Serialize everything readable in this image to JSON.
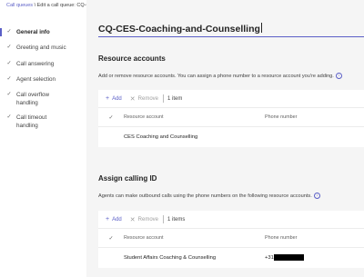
{
  "breadcrumb": {
    "parent": "Call queues",
    "separator": "\\",
    "current": "Edit a call queue: CQ-CES-Coaching-and-Counselling"
  },
  "sidebar": {
    "items": [
      {
        "label": "General info",
        "active": true,
        "checked": true
      },
      {
        "label": "Greeting and music",
        "active": false,
        "checked": true
      },
      {
        "label": "Call answering",
        "active": false,
        "checked": true
      },
      {
        "label": "Agent selection",
        "active": false,
        "checked": true
      },
      {
        "label": "Call overflow handling",
        "active": false,
        "checked": true
      },
      {
        "label": "Call timeout handling",
        "active": false,
        "checked": true
      }
    ]
  },
  "queue_name": "CQ-CES-Coaching-and-Counselling",
  "resource_accounts": {
    "title": "Resource accounts",
    "description": "Add or remove resource accounts. You can assign a phone number to a resource account you're adding.",
    "toolbar": {
      "add": "Add",
      "remove": "Remove",
      "count": "1 item"
    },
    "columns": {
      "name": "Resource account",
      "phone": "Phone number"
    },
    "rows": [
      {
        "name": "CES Coaching and Counselling",
        "phone": ""
      }
    ]
  },
  "calling_id": {
    "title": "Assign calling ID",
    "description": "Agents can make outbound calls using the phone numbers on the following resource accounts.",
    "toolbar": {
      "add": "Add",
      "remove": "Remove",
      "count": "1 items"
    },
    "columns": {
      "name": "Resource account",
      "phone": "Phone number"
    },
    "rows": [
      {
        "name": "Student Affairs Coaching & Counselling",
        "phone": "+31"
      }
    ]
  },
  "icons": {
    "check": "checkmark-icon",
    "add": "plus-icon",
    "remove": "x-icon",
    "info": "info-icon"
  },
  "colors": {
    "accent": "#5b5fc7",
    "background": "#f5f5f5"
  }
}
